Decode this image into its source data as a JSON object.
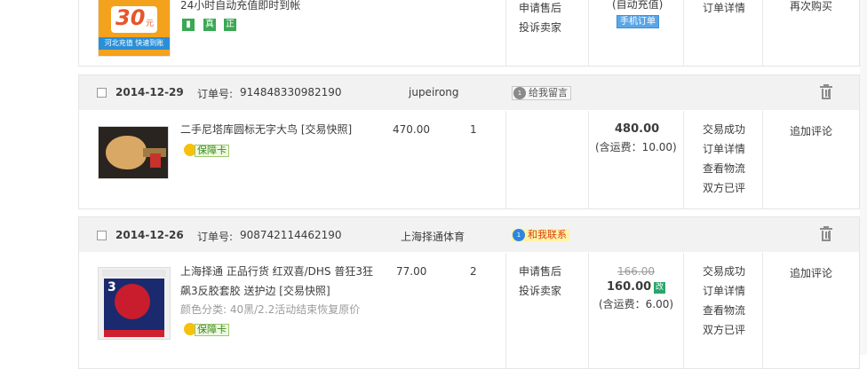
{
  "order0": {
    "promo_desc": "24小时自动充值即时到帐",
    "promo_tags": [
      "真",
      "正"
    ],
    "thumb_big": "30",
    "thumb_unit": "元",
    "thumb_caption": "河北充值 快速到账",
    "links_col1": [
      "申请售后",
      "投诉卖家"
    ],
    "status": "(自动充值)",
    "status_badge": "手机订单",
    "links_col2": [
      "订单详情"
    ],
    "action": "再次购买"
  },
  "order1": {
    "date": "2014-12-29",
    "order_label": "订单号:",
    "order_no": "914848330982190",
    "seller": "jupeirong",
    "msg_label": "给我留言",
    "msg_dot": "1",
    "title": "二手尼塔库圆标无字大鸟 [交易快照]",
    "guarantee": "保障卡",
    "unit_price": "470.00",
    "qty": "1",
    "total": "480.00",
    "shipping": "(含运费：10.00)",
    "status_links": [
      "交易成功",
      "订单详情",
      "查看物流",
      "双方已评"
    ],
    "action": "追加评论"
  },
  "order2": {
    "date": "2014-12-26",
    "order_label": "订单号:",
    "order_no": "908742114462190",
    "seller": "上海择通体育",
    "msg_label": "和我联系",
    "msg_dot": "1",
    "title_line1": "上海择通 正品行货 红双喜/DHS 普狂3狂",
    "title_line2": "飙3反胶套胶 送护边 [交易快照]",
    "sku": "颜色分类: 40黑/2.2活动结束恢复原价",
    "guarantee": "保障卡",
    "unit_price": "77.00",
    "qty": "2",
    "after_sale": [
      "申请售后",
      "投诉卖家"
    ],
    "orig_price": "166.00",
    "total": "160.00",
    "price_badge": "改",
    "shipping": "(含运费：6.00)",
    "status_links": [
      "交易成功",
      "订单详情",
      "查看物流",
      "双方已评"
    ],
    "action": "追加评论"
  },
  "colors": {
    "header_bg": "#f2f2f2",
    "border": "#e5e5e5",
    "badge_blue": "#5ba6e6",
    "price_badge": "#2aa66c",
    "guarantee_green": "#3a8a1c"
  },
  "icons": [
    "trash-icon",
    "message-icon",
    "checkbox",
    "guarantee-icon",
    "phone-icon"
  ]
}
